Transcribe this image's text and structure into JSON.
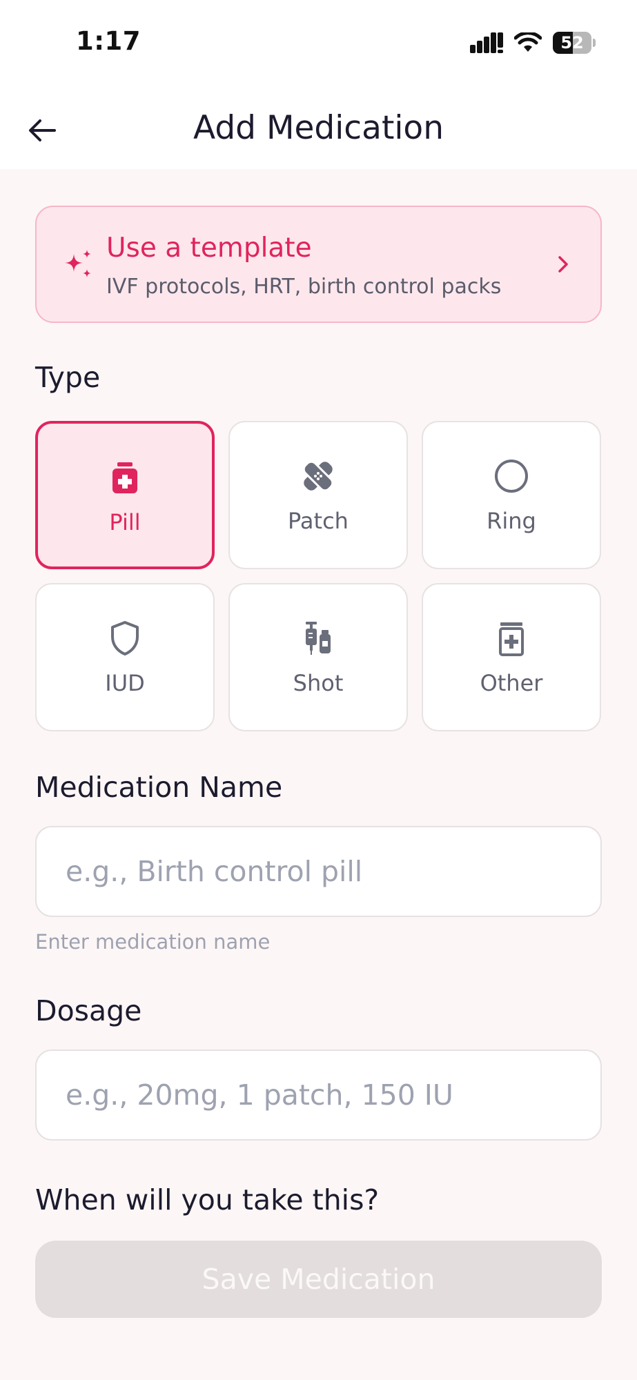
{
  "status_bar": {
    "time": "1:17",
    "battery_level": "52"
  },
  "header": {
    "title": "Add Medication"
  },
  "template_card": {
    "title": "Use a template",
    "subtitle": "IVF protocols, HRT, birth control packs"
  },
  "type_section": {
    "label": "Type",
    "selected": "Pill",
    "options": [
      {
        "label": "Pill",
        "icon": "pill-bottle-icon"
      },
      {
        "label": "Patch",
        "icon": "bandage-icon"
      },
      {
        "label": "Ring",
        "icon": "ring-icon"
      },
      {
        "label": "IUD",
        "icon": "shield-icon"
      },
      {
        "label": "Shot",
        "icon": "syringe-icon"
      },
      {
        "label": "Other",
        "icon": "medicine-box-icon"
      }
    ]
  },
  "medication_name": {
    "label": "Medication Name",
    "value": "",
    "placeholder": "e.g., Birth control pill",
    "helper": "Enter medication name"
  },
  "dosage": {
    "label": "Dosage",
    "value": "",
    "placeholder": "e.g., 20mg, 1 patch, 150 IU"
  },
  "schedule": {
    "label": "When will you take this?"
  },
  "save_button": {
    "label": "Save Medication",
    "enabled": false
  },
  "colors": {
    "accent": "#e0245e",
    "accent_bg": "#fde7ec",
    "page_bg": "#fdf6f6",
    "disabled_button": "#e3dddd"
  }
}
